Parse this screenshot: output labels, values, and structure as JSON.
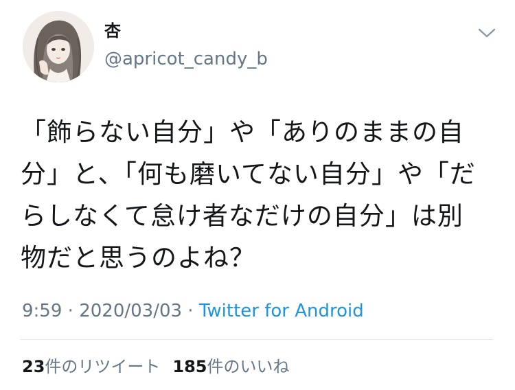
{
  "user": {
    "display_name": "杏",
    "handle": "@apricot_candy_b"
  },
  "tweet": {
    "lines": [
      "「飾らない自分」や「ありのままの自",
      "分」と、「何も磨いてない自分」や「だ",
      "らしなくて怠け者なだけの自分」は別",
      "物だと思うのよね？"
    ]
  },
  "meta": {
    "time": "9:59",
    "separator": " · ",
    "date": "2020/03/03",
    "source": "Twitter for Android"
  },
  "stats": {
    "retweets_count": "23",
    "retweets_label": "件のリツイート",
    "likes_count": "185",
    "likes_label": "件のいいね"
  },
  "icons": {
    "menu": "chevron-down-icon"
  },
  "colors": {
    "text": "#14171a",
    "secondary": "#657786",
    "link": "#1b95e0",
    "divider": "#e1e8ed"
  }
}
